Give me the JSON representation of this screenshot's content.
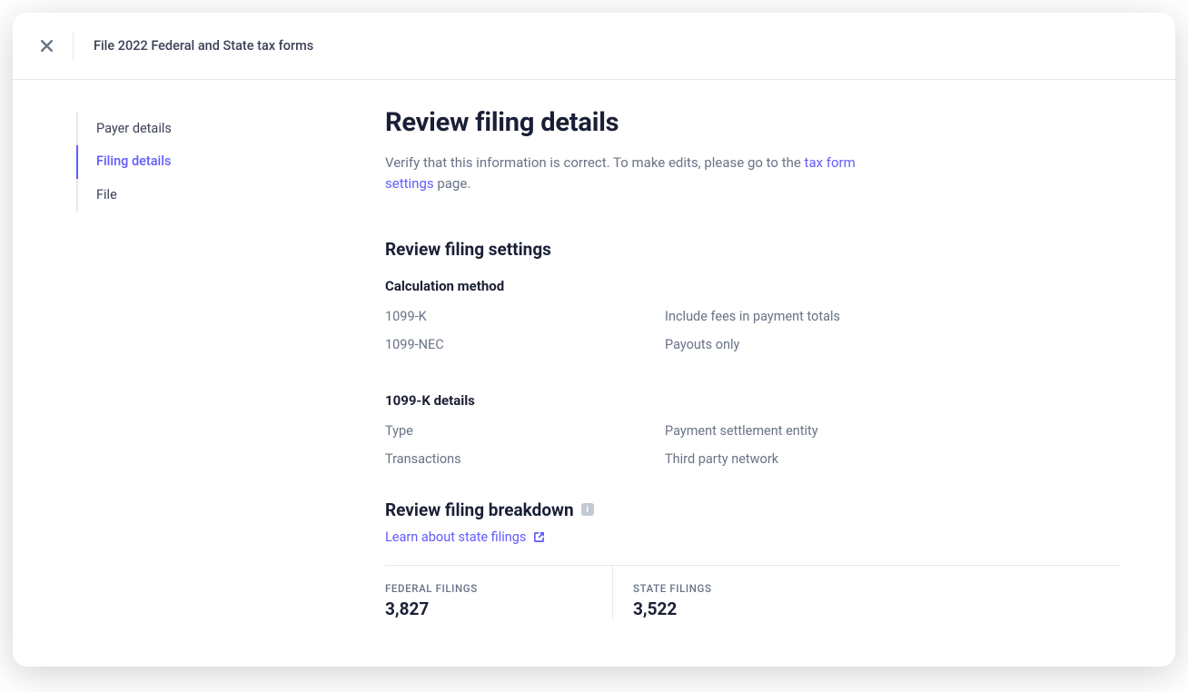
{
  "header": {
    "title": "File 2022 Federal and State tax forms"
  },
  "sidebar": {
    "items": [
      {
        "label": "Payer details",
        "active": false
      },
      {
        "label": "Filing details",
        "active": true
      },
      {
        "label": "File",
        "active": false
      }
    ]
  },
  "main": {
    "title": "Review filing details",
    "subtitle_pre": "Verify that this information is correct. To make edits, please go to the ",
    "subtitle_link": "tax form settings",
    "subtitle_post": " page.",
    "settings_heading": "Review filing settings",
    "calc_heading": "Calculation method",
    "calc_rows": [
      {
        "key": "1099-K",
        "val": "Include fees in payment totals"
      },
      {
        "key": "1099-NEC",
        "val": "Payouts only"
      }
    ],
    "kdetails_heading": "1099-K details",
    "kdetails_rows": [
      {
        "key": "Type",
        "val": "Payment settlement entity"
      },
      {
        "key": "Transactions",
        "val": "Third party network"
      }
    ],
    "breakdown_heading": "Review filing breakdown",
    "learn_link": "Learn about state filings",
    "stats": [
      {
        "label": "FEDERAL FILINGS",
        "value": "3,827"
      },
      {
        "label": "STATE FILINGS",
        "value": "3,522"
      }
    ]
  }
}
